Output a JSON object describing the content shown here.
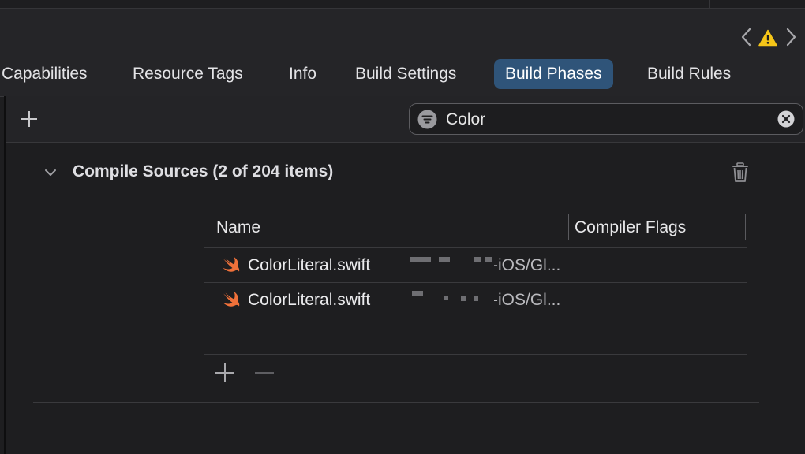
{
  "tabs": [
    {
      "label": "Capabilities",
      "active": false
    },
    {
      "label": "Resource Tags",
      "active": false
    },
    {
      "label": "Info",
      "active": false
    },
    {
      "label": "Build Settings",
      "active": false
    },
    {
      "label": "Build Phases",
      "active": true
    },
    {
      "label": "Build Rules",
      "active": false
    }
  ],
  "search": {
    "value": "Color"
  },
  "section": {
    "title": "Compile Sources (2 of 204 items)"
  },
  "table": {
    "columns": [
      "Name",
      "Compiler Flags"
    ],
    "rows": [
      {
        "name": "ColorLiteral.swift",
        "path": "-iOS/Gl..."
      },
      {
        "name": "ColorLiteral.swift",
        "path": "-iOS/Gl..."
      }
    ]
  },
  "icons": {
    "nav_back": "chevron-left-icon",
    "nav_forward": "chevron-right-icon",
    "warning": "warning-icon",
    "add": "plus-icon",
    "filter": "filter-icon",
    "clear": "clear-icon",
    "disclosure": "chevron-down-icon",
    "delete": "trash-icon",
    "file": "swift-icon",
    "remove": "minus-icon"
  },
  "colors": {
    "background": "#1e1e20",
    "active_tab": "#2f5479",
    "warning": "#f5c518",
    "swift": "#f0713a"
  }
}
